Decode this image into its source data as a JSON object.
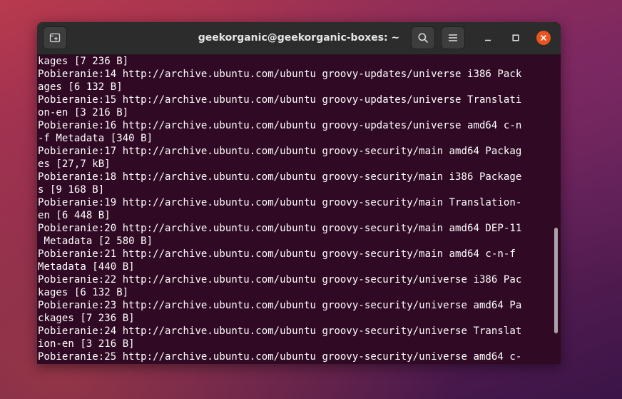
{
  "window": {
    "title": "geekorganic@geekorganic-boxes: ~",
    "icons": {
      "new_tab": "new-tab-icon",
      "search": "search-icon",
      "menu": "hamburger-menu-icon",
      "minimize": "minimize-icon",
      "maximize": "maximize-icon",
      "close": "close-icon"
    },
    "colors": {
      "terminal_bg": "#300a24",
      "close_button": "#e95420",
      "titlebar": "#2c2c2c"
    }
  },
  "terminal": {
    "lines": [
      "kages [7 236 B]",
      "Pobieranie:14 http://archive.ubuntu.com/ubuntu groovy-updates/universe i386 Pack",
      "ages [6 132 B]",
      "Pobieranie:15 http://archive.ubuntu.com/ubuntu groovy-updates/universe Translati",
      "on-en [3 216 B]",
      "Pobieranie:16 http://archive.ubuntu.com/ubuntu groovy-updates/universe amd64 c-n",
      "-f Metadata [340 B]",
      "Pobieranie:17 http://archive.ubuntu.com/ubuntu groovy-security/main amd64 Packag",
      "es [27,7 kB]",
      "Pobieranie:18 http://archive.ubuntu.com/ubuntu groovy-security/main i386 Package",
      "s [9 168 B]",
      "Pobieranie:19 http://archive.ubuntu.com/ubuntu groovy-security/main Translation-",
      "en [6 448 B]",
      "Pobieranie:20 http://archive.ubuntu.com/ubuntu groovy-security/main amd64 DEP-11",
      " Metadata [2 580 B]",
      "Pobieranie:21 http://archive.ubuntu.com/ubuntu groovy-security/main amd64 c-n-f",
      "Metadata [440 B]",
      "Pobieranie:22 http://archive.ubuntu.com/ubuntu groovy-security/universe i386 Pac",
      "kages [6 132 B]",
      "Pobieranie:23 http://archive.ubuntu.com/ubuntu groovy-security/universe amd64 Pa",
      "ckages [7 236 B]",
      "Pobieranie:24 http://archive.ubuntu.com/ubuntu groovy-security/universe Translat",
      "ion-en [3 216 B]",
      "Pobieranie:25 http://archive.ubuntu.com/ubuntu groovy-security/universe amd64 c-"
    ]
  }
}
